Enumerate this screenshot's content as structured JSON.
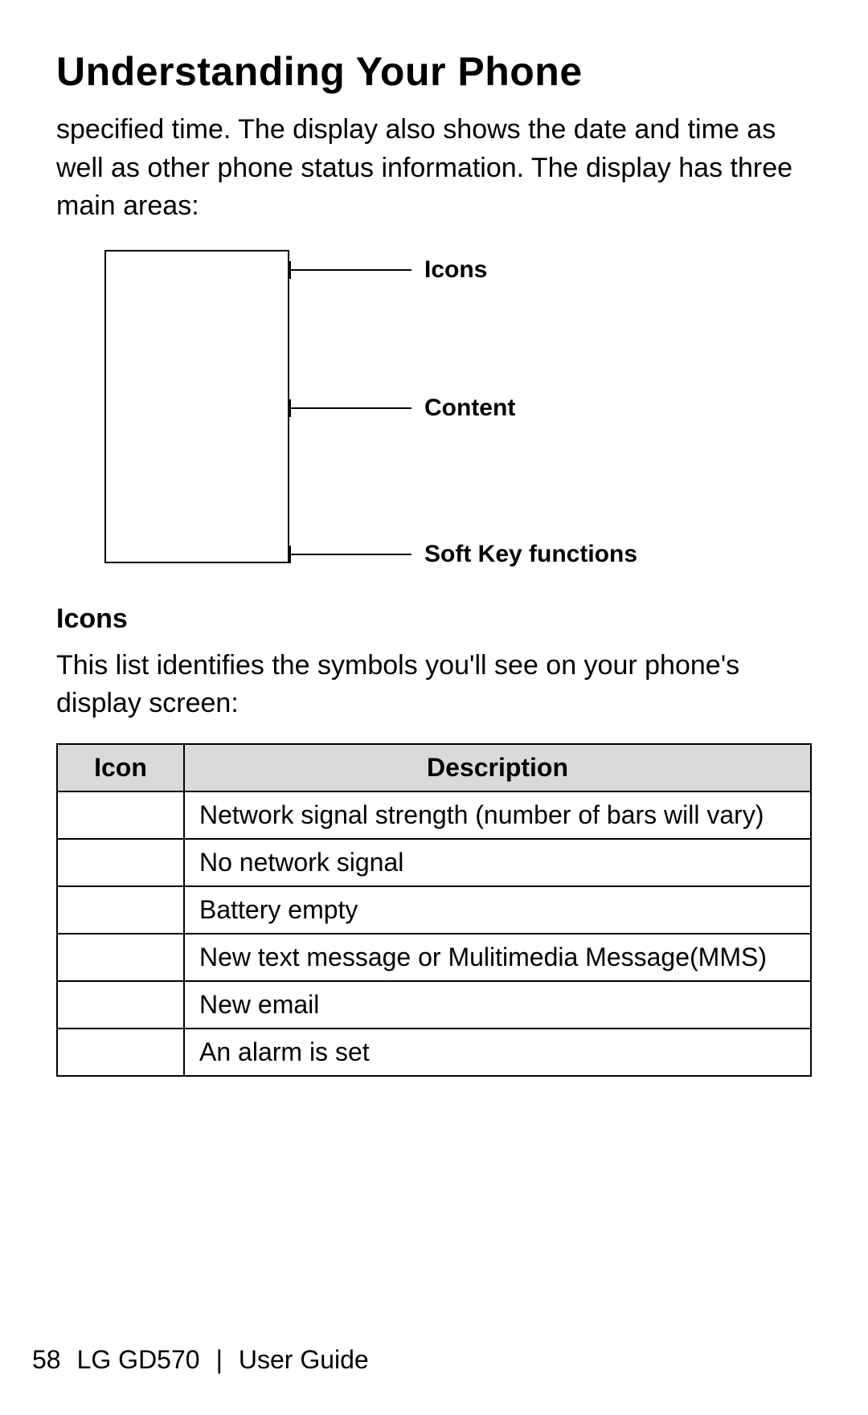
{
  "title": "Understanding Your Phone",
  "intro_text": "specified time. The display also shows the date and time as well as other phone status information. The display has three main areas:",
  "diagram": {
    "label_top": "Icons",
    "label_middle": "Content",
    "label_bottom": "Soft Key functions"
  },
  "subhead": "Icons",
  "body_text": "This list identifies the symbols you'll see on your phone's display screen:",
  "table": {
    "header_icon": "Icon",
    "header_desc": "Description",
    "rows": [
      {
        "icon": "",
        "desc": "Network signal strength (number of bars will vary)"
      },
      {
        "icon": "",
        "desc": "No network signal"
      },
      {
        "icon": "",
        "desc": "Battery empty"
      },
      {
        "icon": "",
        "desc": "New text message or Mulitimedia Message(MMS)"
      },
      {
        "icon": "",
        "desc": "New email"
      },
      {
        "icon": "",
        "desc": "An alarm is set"
      }
    ]
  },
  "footer": {
    "page_number": "58",
    "model": "LG GD570",
    "divider": "|",
    "doc_title": "User Guide"
  }
}
